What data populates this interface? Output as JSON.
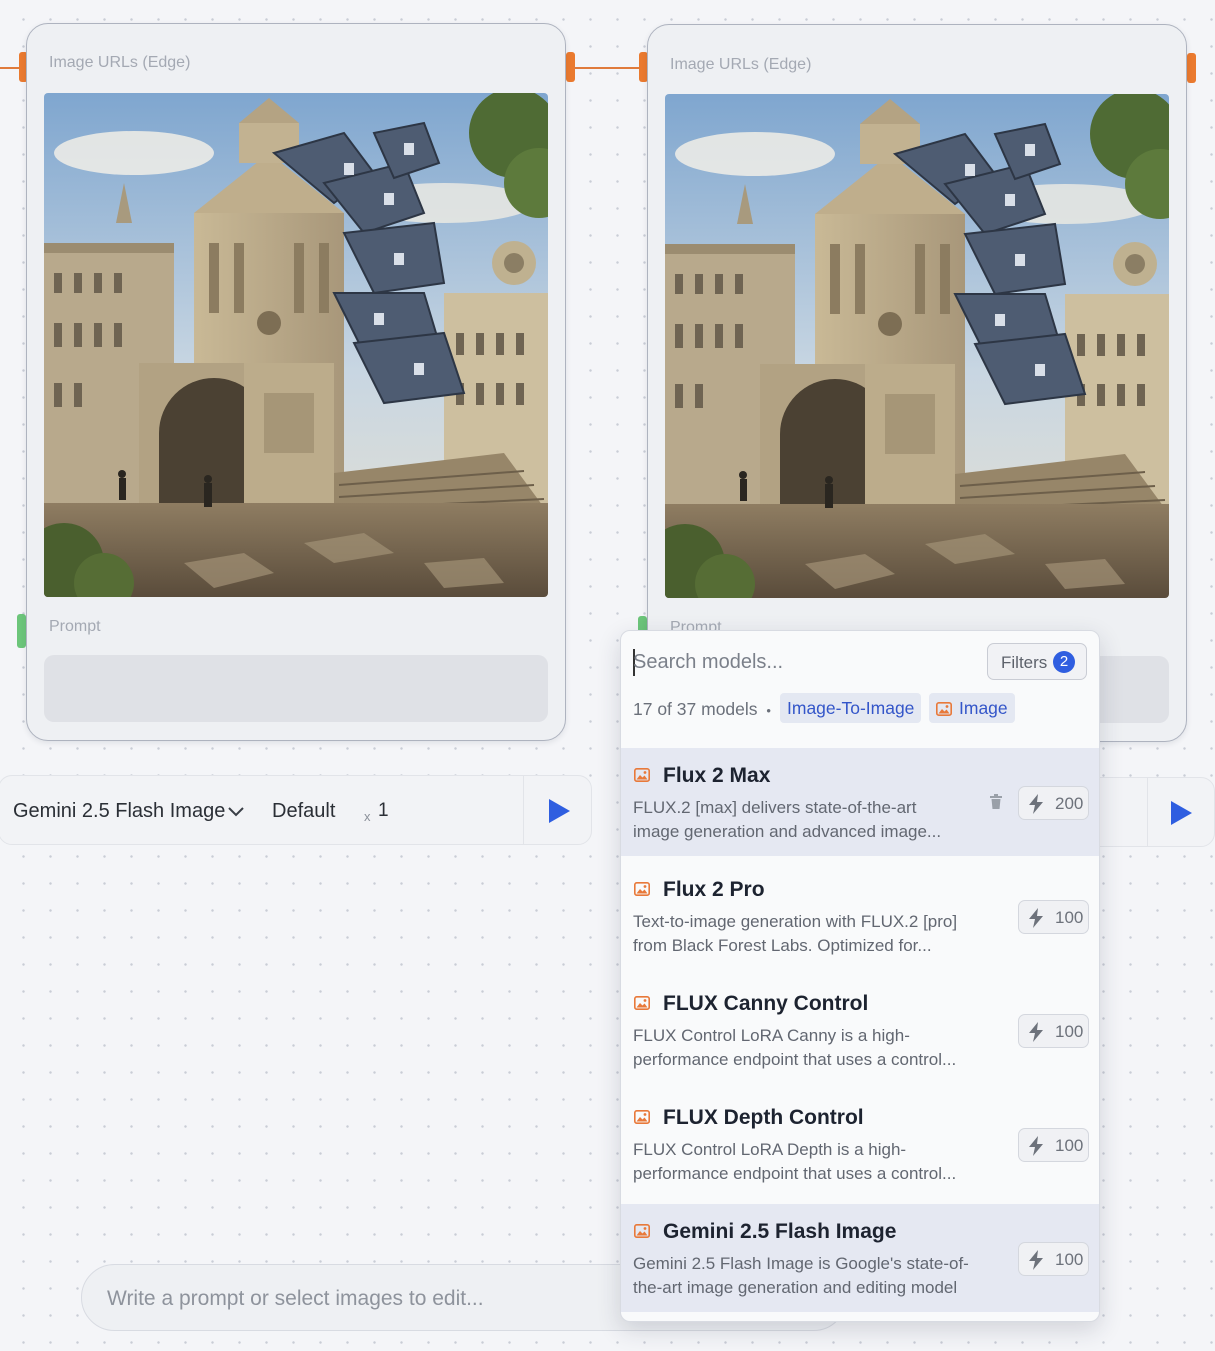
{
  "colors": {
    "accent": "#2f5ee0",
    "edge_orange": "#ea7a2f",
    "port_green": "#6cc57a",
    "icon_orange": "#e8793a"
  },
  "nodes": [
    {
      "image_label": "Image URLs (Edge)",
      "prompt_label": "Prompt"
    },
    {
      "image_label": "Image URLs (Edge)",
      "prompt_label": "Prompt"
    }
  ],
  "runbar": {
    "model": "Gemini 2.5 Flash Image",
    "preset": "Default",
    "multiplier": "x",
    "count": "1"
  },
  "chat": {
    "placeholder": "Write a prompt or select images to edit..."
  },
  "model_picker": {
    "search_placeholder": "Search models...",
    "filters_label": "Filters",
    "filters_count": "2",
    "count_text": "17 of 37 models",
    "separator": "•",
    "chips": [
      "Image-To-Image",
      "Image"
    ],
    "models": [
      {
        "name": "Flux 2 Max",
        "desc_line1": "FLUX.2 [max] delivers state-of-the-art",
        "desc_line2": "image generation and advanced image...",
        "cost": "200",
        "highlighted": true
      },
      {
        "name": "Flux 2 Pro",
        "desc_line1": "Text-to-image generation with FLUX.2 [pro]",
        "desc_line2": "from Black Forest Labs. Optimized for...",
        "cost": "100",
        "highlighted": false
      },
      {
        "name": "FLUX Canny Control",
        "desc_line1": "FLUX Control LoRA Canny is a high-",
        "desc_line2": "performance endpoint that uses a control...",
        "cost": "100",
        "highlighted": false
      },
      {
        "name": "FLUX Depth Control",
        "desc_line1": "FLUX Control LoRA Depth is a high-",
        "desc_line2": "performance endpoint that uses a control...",
        "cost": "100",
        "highlighted": false
      },
      {
        "name": "Gemini 2.5 Flash Image",
        "desc_line1": "Gemini 2.5 Flash Image is Google's state-of-",
        "desc_line2": "the-art image generation and editing model",
        "cost": "100",
        "highlighted": true
      }
    ]
  }
}
